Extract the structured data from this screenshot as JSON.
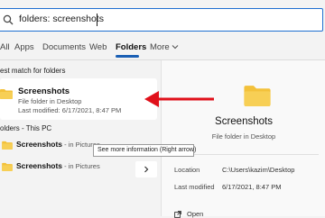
{
  "search": {
    "value": "folders: screenshots"
  },
  "tabs": [
    {
      "label": "All"
    },
    {
      "label": "Apps"
    },
    {
      "label": "Documents"
    },
    {
      "label": "Web"
    },
    {
      "label": "Folders"
    },
    {
      "label": "More"
    }
  ],
  "best_match": {
    "section_label": "est match for folders",
    "title": "Screenshots",
    "type": "File folder in Desktop",
    "modified": "Last modified: 6/17/2021, 8:47 PM"
  },
  "folders_section": {
    "label": "olders - This PC",
    "items": [
      {
        "name": "Screenshots",
        "location": " - in Pictures"
      },
      {
        "name": "Screenshots",
        "location": " - in Pictures"
      }
    ]
  },
  "tooltip": "See more information (Right arrow)",
  "preview": {
    "title": "Screenshots",
    "subtitle": "File folder in Desktop",
    "location_label": "Location",
    "location_value": "C:\\Users\\kazim\\Desktop",
    "modified_label": "Last modified",
    "modified_value": "6/17/2021, 8:47 PM",
    "open_label": "Open"
  },
  "colors": {
    "accent": "#1a5fb4",
    "folder": "#f3c13a",
    "arrow": "#e0101a"
  },
  "icons": [
    "search-icon",
    "chevron-down-icon",
    "folder-icon",
    "chevron-right-icon",
    "open-icon"
  ]
}
